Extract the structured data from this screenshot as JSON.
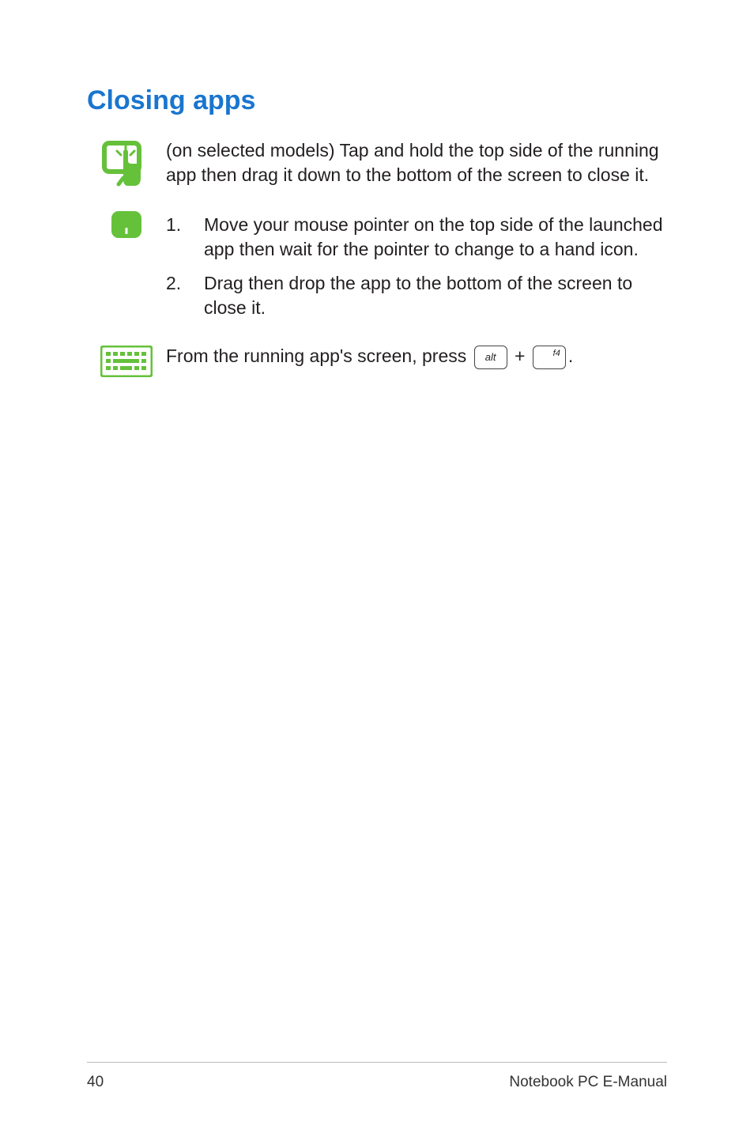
{
  "heading": "Closing apps",
  "touch": {
    "text": "(on selected models) Tap and hold the top side of the running app then drag it down to the bottom of the screen to close it."
  },
  "mouse": {
    "steps": [
      {
        "num": "1.",
        "text": "Move your mouse pointer on the top side of the launched app then wait for the pointer to change to a hand icon."
      },
      {
        "num": "2.",
        "text": "Drag then drop the app to the bottom of the screen to close it."
      }
    ]
  },
  "keyboard": {
    "prefix": "From the running app's screen, press ",
    "key1": "alt",
    "plus": " + ",
    "key2": "f4",
    "suffix": "."
  },
  "footer": {
    "page": "40",
    "title": "Notebook PC E-Manual"
  }
}
